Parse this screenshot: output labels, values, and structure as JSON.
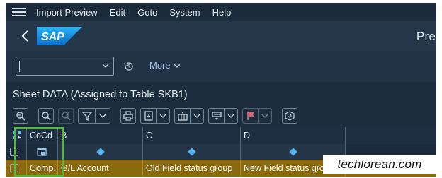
{
  "menu": {
    "items": [
      {
        "label": "Import Preview"
      },
      {
        "label": "Edit"
      },
      {
        "label": "Goto"
      },
      {
        "label": "System"
      },
      {
        "label": "Help"
      }
    ]
  },
  "shell": {
    "title": "Prev",
    "logo_text": "SAP"
  },
  "variant_bar": {
    "combo_value": "",
    "more_label": "More"
  },
  "sheet": {
    "title": "Sheet DATA (Assigned to Table SKB1)"
  },
  "toolbar": {
    "icons": [
      "zoom-icon",
      "search-icon",
      "search-next-icon",
      "filter-icon",
      "print-icon",
      "export-icon",
      "layout-icon",
      "settings-icon",
      "flag-icon",
      "refresh-icon"
    ]
  },
  "table": {
    "headers": [
      "CoCd",
      "B",
      "C",
      "D"
    ],
    "row": [
      "Comp.",
      "G/L Account",
      "Old Field status group",
      "New Field status group"
    ]
  },
  "colors": {
    "shell_bg": "#23364a",
    "selected_row": "#8a6a0c",
    "highlight_box": "#4cbb2e",
    "accent_link": "#a9c7e3"
  },
  "watermark": "techlorean.com"
}
